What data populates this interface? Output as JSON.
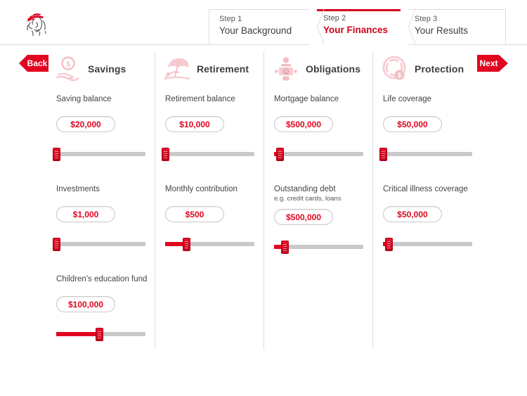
{
  "header": {
    "logo_name": "face-emblem-logo",
    "tabs": [
      {
        "step": "Step 1",
        "name": "Your Background",
        "active": false
      },
      {
        "step": "Step 2",
        "name": "Your Finances",
        "active": true
      },
      {
        "step": "Step 3",
        "name": "Your Results",
        "active": false
      }
    ]
  },
  "nav": {
    "back_label": "Back",
    "next_label": "Next"
  },
  "colors": {
    "brand_red": "#e1061f",
    "accent_red": "#d6001c",
    "track_gray": "#c9c9c9",
    "text_dark": "#3e3e42"
  },
  "columns": [
    {
      "title": "Savings",
      "icon": "hand-holding-coin-icon",
      "fields": [
        {
          "label": "Saving balance",
          "sub": "",
          "value": "$20,000",
          "slider_percent": 0
        },
        {
          "label": "Investments",
          "sub": "",
          "value": "$1,000",
          "slider_percent": 0
        },
        {
          "label": "Children's education fund",
          "sub": "",
          "value": "$100,000",
          "slider_percent": 48
        }
      ]
    },
    {
      "title": "Retirement",
      "icon": "beach-umbrella-lounger-icon",
      "fields": [
        {
          "label": "Retirement balance",
          "sub": "",
          "value": "$10,000",
          "slider_percent": 0
        },
        {
          "label": "Monthly contribution",
          "sub": "",
          "value": "$500",
          "slider_percent": 24
        }
      ]
    },
    {
      "title": "Obligations",
      "icon": "person-with-money-icon",
      "fields": [
        {
          "label": "Mortgage balance",
          "sub": "",
          "value": "$500,000",
          "slider_percent": 6
        },
        {
          "label": "Outstanding debt",
          "sub": "e.g. credit cards, loans",
          "value": "$500,000",
          "slider_percent": 12
        }
      ]
    },
    {
      "title": "Protection",
      "icon": "life-ring-coin-icon",
      "fields": [
        {
          "label": "Life coverage",
          "sub": "",
          "value": "$50,000",
          "slider_percent": 0
        },
        {
          "label": "Critical illness coverage",
          "sub": "",
          "value": "$50,000",
          "slider_percent": 6
        }
      ]
    }
  ]
}
